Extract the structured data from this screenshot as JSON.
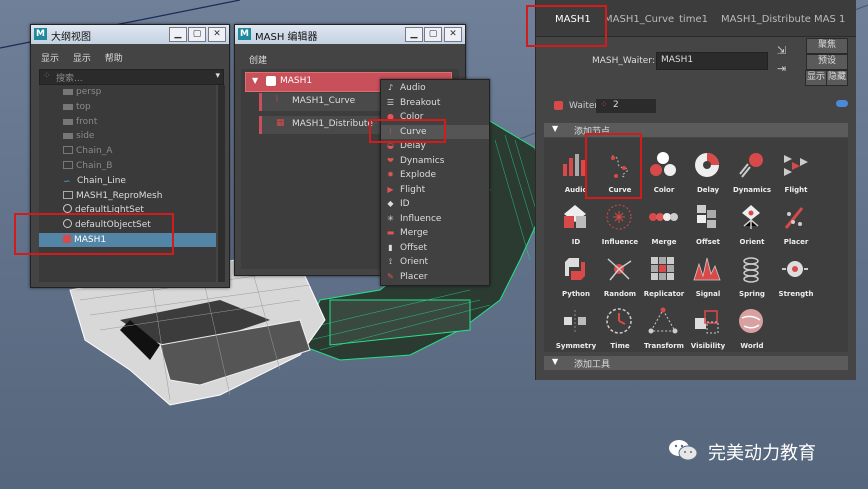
{
  "outliner": {
    "title": "大纲视图",
    "menu": [
      "显示",
      "显示",
      "帮助"
    ],
    "search_placeholder": "搜索...",
    "items": [
      {
        "label": "persp",
        "dim": true
      },
      {
        "label": "top",
        "dim": true
      },
      {
        "label": "front",
        "dim": true
      },
      {
        "label": "side",
        "dim": true
      },
      {
        "label": "Chain_A",
        "dim": true
      },
      {
        "label": "Chain_B",
        "dim": true
      },
      {
        "label": "Chain_Line",
        "dim": false
      },
      {
        "label": "MASH1_ReproMesh",
        "dim": false
      },
      {
        "label": "defaultLightSet",
        "dim": false
      },
      {
        "label": "defaultObjectSet",
        "dim": false
      },
      {
        "label": "MASH1",
        "dim": false,
        "selected": true
      }
    ]
  },
  "mash_editor": {
    "title": "MASH 编辑器",
    "menu": "创建",
    "network": "MASH1",
    "children": [
      "MASH1_Curve",
      "MASH1_Distribute"
    ]
  },
  "context_menu": {
    "items": [
      "Audio",
      "Breakout",
      "Color",
      "Curve",
      "Delay",
      "Dynamics",
      "Explode",
      "Flight",
      "ID",
      "Influence",
      "Merge",
      "Offset",
      "Orient",
      "Placer"
    ],
    "highlighted": "Curve"
  },
  "attr_editor": {
    "tabs": [
      "MASH1",
      "MASH1_Curve",
      "time1",
      "MASH1_Distribute",
      "MAS 1"
    ],
    "active_tab": "MASH1",
    "waiter_label": "MASH_Waiter:",
    "waiter_value": "MASH1",
    "buttons": [
      "聚焦",
      "预设",
      "显示",
      "隐藏"
    ],
    "waiter_section_label": "Waiter",
    "waiter_count": "2",
    "add_node_header": "添加节点",
    "nodes": [
      "Audio",
      "Curve",
      "Color",
      "Delay",
      "Dynamics",
      "Flight",
      "ID",
      "Influence",
      "Merge",
      "Offset",
      "Orient",
      "Placer",
      "Python",
      "Random",
      "Replicator",
      "Signal",
      "Spring",
      "Strength",
      "Symmetry",
      "Time",
      "Transform",
      "Visibility",
      "World"
    ],
    "add_utility_header": "添加工具"
  },
  "watermark": "完美动力教育"
}
